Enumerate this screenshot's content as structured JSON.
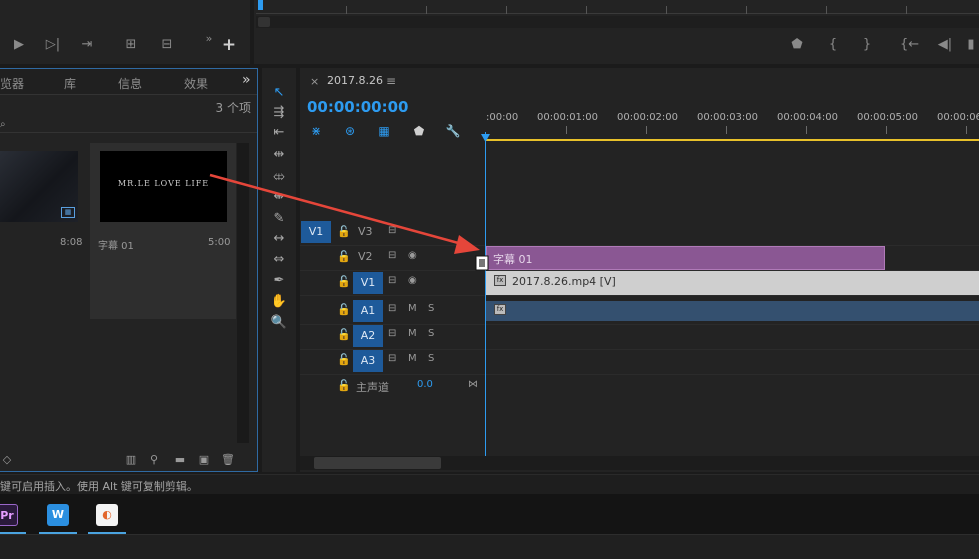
{
  "project": {
    "tabs": [
      "览器",
      "库",
      "信息",
      "效果"
    ],
    "more": "»",
    "item_count": "3 个项",
    "items": [
      {
        "duration": "8:08"
      },
      {
        "name": "字幕 01",
        "duration": "5:00",
        "thumb_text": "MR.LE LOVE LIFE"
      }
    ]
  },
  "timeline": {
    "close": "×",
    "sequence_name": "2017.8.26",
    "menu": "≡",
    "timecode": "00:00:00:00",
    "ruler": [
      ":00:00",
      "00:00:01:00",
      "00:00:02:00",
      "00:00:03:00",
      "00:00:04:00",
      "00:00:05:00",
      "00:00:06"
    ],
    "source_patch": "V1",
    "tracks": {
      "v3": "V3",
      "v2": "V2",
      "v1": "V1",
      "a1": "A1",
      "a2": "A2",
      "a3": "A3",
      "master": "主声道",
      "master_value": "0.0",
      "mute": "M",
      "solo": "S"
    },
    "clips": {
      "title": "字幕 01",
      "video": "2017.8.26.mp4 [V]"
    }
  },
  "status": {
    "text": "键可启用插入。使用 Alt 键可复制剪辑。"
  },
  "taskbar": {
    "apps": [
      "Pr",
      "W",
      "◐"
    ]
  },
  "colors": {
    "accent": "#2d9bf0",
    "title_clip": "#8a5793",
    "audio_clip": "#34506f",
    "video_clip": "#cfcfcf",
    "arrow": "#e5463a",
    "work_area": "#e8c12a"
  },
  "icons": {
    "source_controls": [
      "play-icon",
      "step-forward-icon",
      "insert-icon",
      "lift-icon",
      "extract-icon",
      "add-icon"
    ],
    "program_controls": [
      "marker-icon",
      "mark-in-icon",
      "mark-out-icon",
      "go-to-in-icon",
      "step-back-icon"
    ],
    "tools": [
      "selection-tool-icon",
      "track-select-icon",
      "ripple-edit-icon",
      "rolling-edit-icon",
      "rate-stretch-icon",
      "razor-tool-icon",
      "slip-tool-icon",
      "slide-tool-icon",
      "pen-tool-icon",
      "hand-tool-icon",
      "zoom-tool-icon"
    ]
  }
}
